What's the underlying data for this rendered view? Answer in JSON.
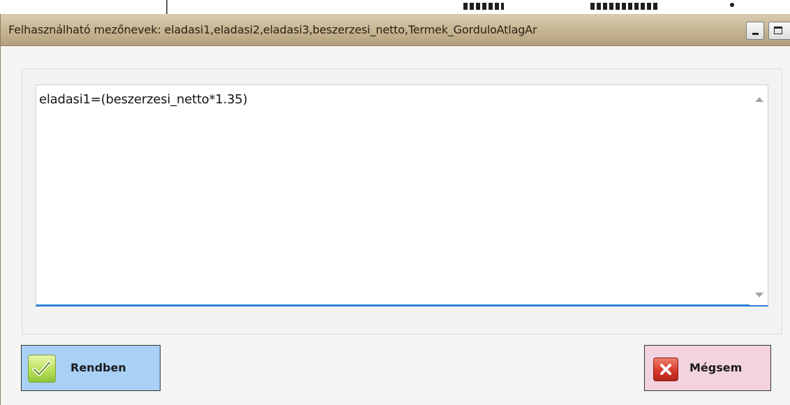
{
  "dialog": {
    "title": "Felhasználható mezőnevek: eladasi1,eladasi2,eladasi3,beszerzesi_netto,Termek_GorduloAtlagAr",
    "formula_text": "eladasi1=(beszerzesi_netto*1.35)"
  },
  "buttons": {
    "ok_label": "Rendben",
    "cancel_label": "Mégsem"
  },
  "icons": {
    "ok": "checkmark-icon",
    "cancel": "x-icon",
    "minimize": "minimize-icon",
    "maximize": "maximize-icon"
  },
  "colors": {
    "titlebar": "#c7b694",
    "ok_button": "#a9d1f6",
    "cancel_button": "#f3d3e0",
    "focus_underline": "#2f7fd6"
  }
}
